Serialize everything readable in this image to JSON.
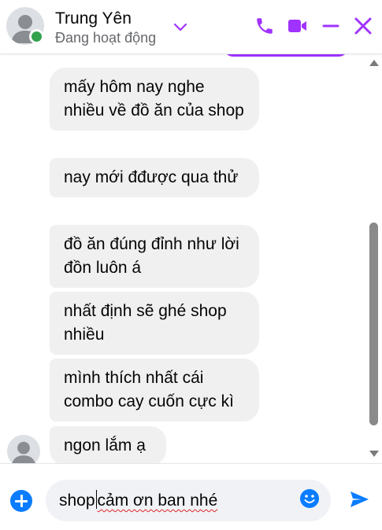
{
  "header": {
    "contact_name": "Trung Yên",
    "status": "Đang hoạt động",
    "icons": [
      "chevron-down-icon",
      "phone-icon",
      "video-icon",
      "minimize-icon",
      "close-icon"
    ],
    "accent_color": "#a033ff"
  },
  "messages": [
    {
      "sender": "contact",
      "text": "mấy hôm nay nghe nhiều về đồ ăn của shop"
    },
    {
      "sender": "contact",
      "text": "nay mới đđược qua thử"
    },
    {
      "sender": "contact",
      "text": "đồ ăn đúng đỉnh như lời đồn luôn á"
    },
    {
      "sender": "contact",
      "text": "nhất định sẽ ghé shop nhiều"
    },
    {
      "sender": "contact",
      "text": "mình thích nhất cái combo cay cuốn cực kì"
    },
    {
      "sender": "contact",
      "text": "ngon lắm ạ"
    }
  ],
  "composer": {
    "typed_before_caret": "shop",
    "typed_after_caret": "cảm ơn ban nhé",
    "icons": [
      "plus-icon",
      "emoji-icon",
      "send-icon"
    ],
    "send_color": "#0a7cff"
  }
}
